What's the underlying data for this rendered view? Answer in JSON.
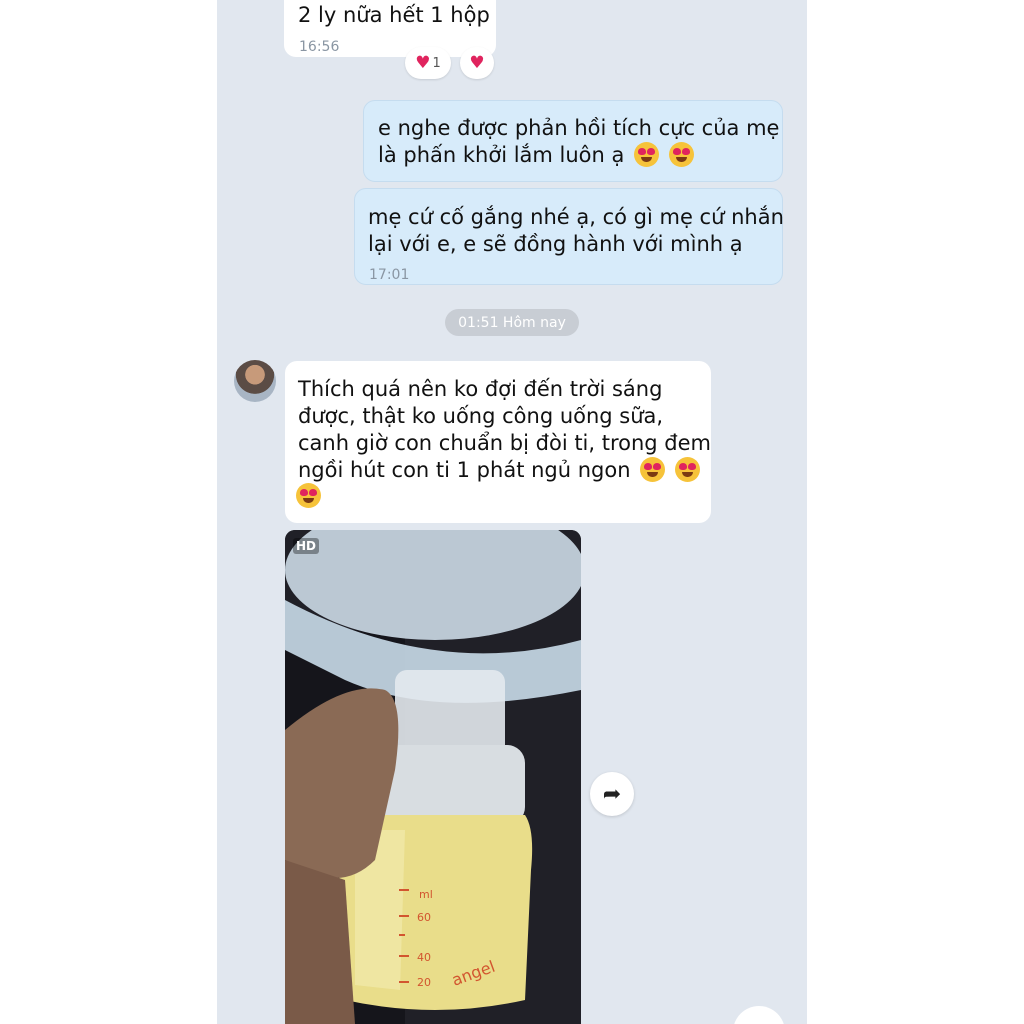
{
  "messages": [
    {
      "text": "2 ly nữa hết 1 hộp",
      "time": "16:56",
      "side": "in"
    },
    {
      "line1": "e nghe được phản hồi tích cực của mẹ",
      "line2": "là phấn khởi lắm luôn ạ",
      "emoji": [
        "heart-eyes",
        "heart-eyes"
      ],
      "side": "out"
    },
    {
      "line1": "mẹ cứ cố gắng nhé ạ, có gì mẹ cứ nhắn",
      "line2": "lại với e, e sẽ đồng hành với mình ạ",
      "time": "17:01",
      "side": "out"
    },
    {
      "line1": "Thích quá nên ko đợi đến trời sáng",
      "line2": "được, thật ko uống công uống sữa,",
      "line3": "canh giờ con chuẩn bị đòi ti, trong đem",
      "line4": "ngồi hút con ti 1 phát ngủ ngon",
      "emoji": [
        "heart-eyes",
        "heart-eyes",
        "heart-eyes"
      ],
      "side": "in"
    }
  ],
  "reactions": [
    {
      "icon": "heart-icon",
      "count": "1"
    },
    {
      "icon": "heart-icon"
    }
  ],
  "date_separator": "01:51 Hôm nay",
  "photo": {
    "badge": "HD",
    "bottle_text": {
      "unit": "ml",
      "marks": [
        "60",
        "40",
        "20"
      ],
      "brand": "angel"
    }
  },
  "share_icon": "share-arrow-icon",
  "colors": {
    "chat_bg": "#e1e7ef",
    "incoming": "#ffffff",
    "outgoing": "#d7ebfa",
    "heart": "#e0245e"
  }
}
